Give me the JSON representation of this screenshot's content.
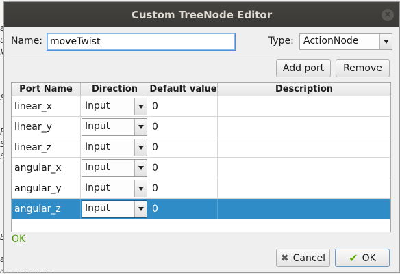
{
  "background": {
    "fragments": [
      "a",
      "u",
      "k",
      "Se",
      "F",
      "S",
      "S",
      "E",
      "a"
    ],
    "bottom_text": "a/duchecklist"
  },
  "dialog": {
    "title": "Custom TreeNode Editor",
    "close_glyph": "×",
    "name_label": "Name:",
    "name_value": "moveTwist",
    "type_label": "Type:",
    "type_value": "ActionNode",
    "add_port_label": "Add port",
    "remove_label": "Remove",
    "table": {
      "headers": [
        "Port Name",
        "Direction",
        "Default value",
        "Description"
      ],
      "rows": [
        {
          "port": "linear_x",
          "direction": "Input",
          "default": "0",
          "description": ""
        },
        {
          "port": "linear_y",
          "direction": "Input",
          "default": "0",
          "description": ""
        },
        {
          "port": "linear_z",
          "direction": "Input",
          "default": "0",
          "description": ""
        },
        {
          "port": "angular_x",
          "direction": "Input",
          "default": "0",
          "description": ""
        },
        {
          "port": "angular_y",
          "direction": "Input",
          "default": "0",
          "description": ""
        },
        {
          "port": "angular_z",
          "direction": "Input",
          "default": "0",
          "description": ""
        }
      ],
      "selected_row": 5
    },
    "status_text": "OK",
    "cancel_label_underlined": "C",
    "cancel_label_rest": "ancel",
    "ok_label_underlined": "O",
    "ok_label_rest": "K"
  },
  "colors": {
    "titlebar": "#3f3e3b",
    "selection": "#308cc6",
    "status_ok": "#4e9a06",
    "focus_border": "#4a90d9"
  },
  "icons": {
    "close": "close-icon",
    "cancel": "x-icon",
    "ok": "check-icon",
    "dropdown": "chevron-down-icon"
  }
}
